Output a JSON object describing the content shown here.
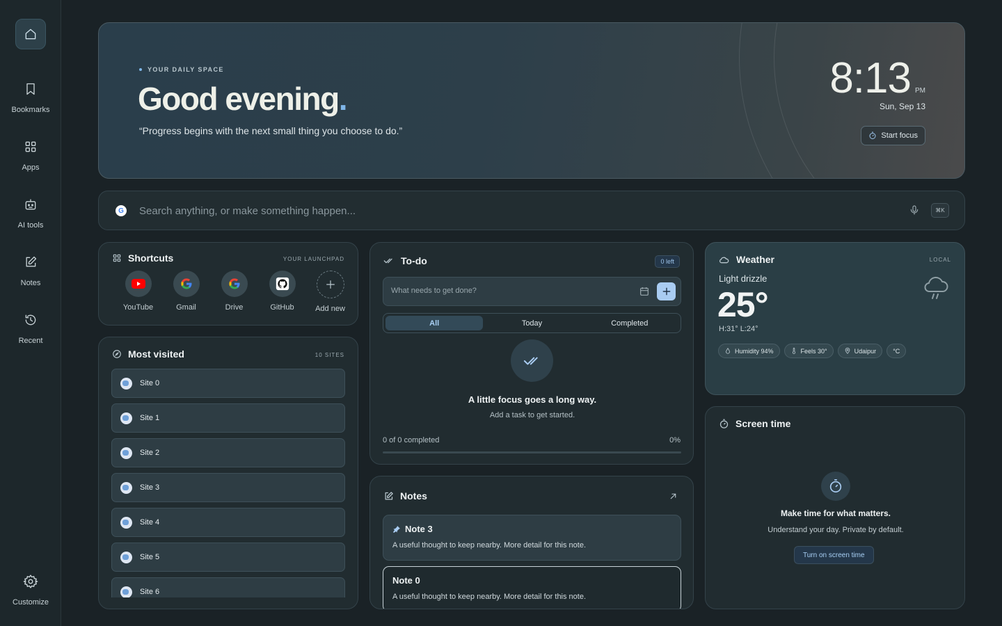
{
  "sidebar": {
    "items": [
      {
        "label": "Bookmarks",
        "icon": "bookmark-icon"
      },
      {
        "label": "Apps",
        "icon": "apps-grid-icon"
      },
      {
        "label": "AI tools",
        "icon": "robot-icon"
      },
      {
        "label": "Notes",
        "icon": "edit-note-icon"
      },
      {
        "label": "Recent",
        "icon": "history-icon"
      }
    ],
    "customize": "Customize"
  },
  "hero": {
    "eyebrow": "YOUR DAILY SPACE",
    "greeting": "Good evening",
    "greeting_punct": ".",
    "quote": "“Progress begins with the next small thing you choose to do.”",
    "time": "8:13",
    "ampm": "PM",
    "date": "Sun, Sep 13",
    "focus_button": "Start focus"
  },
  "search": {
    "placeholder": "Search anything, or make something happen...",
    "shortcut": "⌘K"
  },
  "shortcuts": {
    "title": "Shortcuts",
    "tag": "YOUR LAUNCHPAD",
    "items": [
      {
        "label": "YouTube",
        "icon": "youtube-icon"
      },
      {
        "label": "Gmail",
        "icon": "google-icon"
      },
      {
        "label": "Drive",
        "icon": "google-icon"
      },
      {
        "label": "GitHub",
        "icon": "github-icon"
      },
      {
        "label": "Add new",
        "icon": "plus-icon"
      }
    ]
  },
  "most_visited": {
    "title": "Most visited",
    "tag": "10 SITES",
    "sites": [
      "Site 0",
      "Site 1",
      "Site 2",
      "Site 3",
      "Site 4",
      "Site 5",
      "Site 6"
    ]
  },
  "todo": {
    "title": "To-do",
    "badge": "0 left",
    "input_placeholder": "What needs to get done?",
    "tabs": [
      "All",
      "Today",
      "Completed"
    ],
    "active_tab": "All",
    "empty_title": "A little focus goes a long way.",
    "empty_subtitle": "Add a task to get started.",
    "progress_text": "0 of 0 completed",
    "progress_pct": "0%",
    "progress_value": 0
  },
  "notes": {
    "title": "Notes",
    "items": [
      {
        "title": "Note 3",
        "body": "A useful thought to keep nearby. More detail for this note.",
        "pinned": true
      },
      {
        "title": "Note 0",
        "body": "A useful thought to keep nearby. More detail for this note.",
        "pinned": false
      }
    ]
  },
  "weather": {
    "title": "Weather",
    "tag": "LOCAL",
    "condition": "Light drizzle",
    "temp": "25°",
    "high_low": "H:31° L:24°",
    "chips": {
      "humidity": "Humidity 94%",
      "feels": "Feels 30°",
      "location": "Udaipur",
      "unit": "°C"
    }
  },
  "screen_time": {
    "title": "Screen time",
    "headline": "Make time for what matters.",
    "subtitle": "Understand your day. Private by default.",
    "button": "Turn on screen time"
  },
  "colors": {
    "background": "#1a2226",
    "card": "#212c30",
    "accent": "#7fb6e8",
    "accent_soft": "#a9ccf2"
  }
}
